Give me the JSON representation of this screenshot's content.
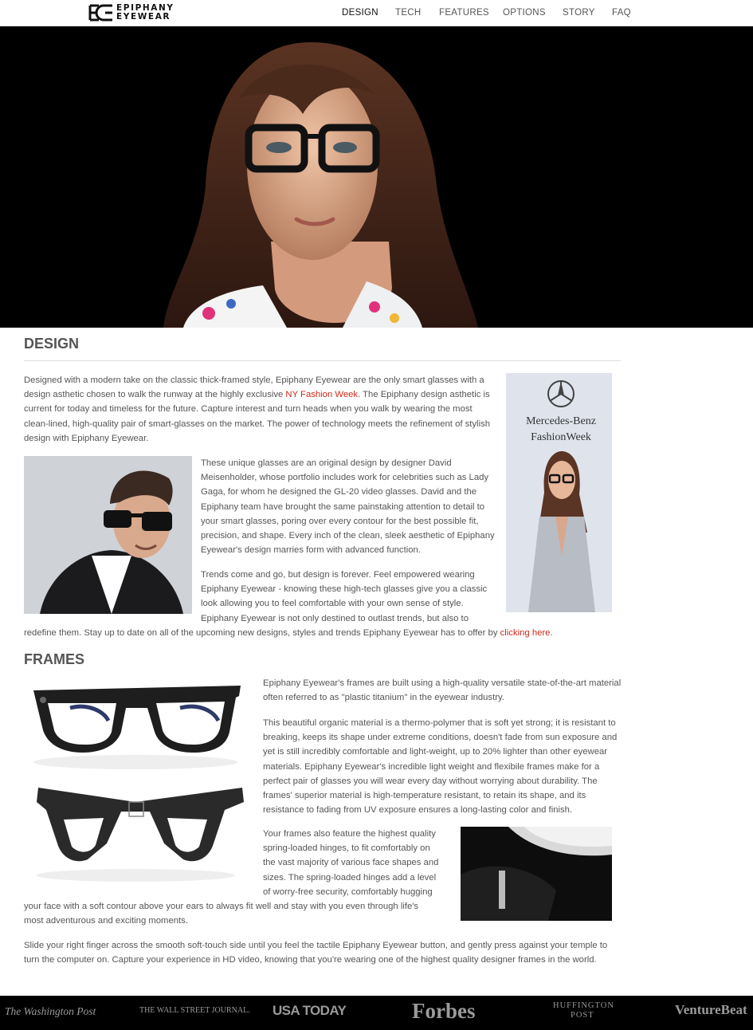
{
  "brand": {
    "line1": "EPIPHANY",
    "line2": "EYEWEAR"
  },
  "nav": {
    "items": [
      {
        "label": "DESIGN",
        "active": true
      },
      {
        "label": "TECH"
      },
      {
        "label": "FEATURES"
      },
      {
        "label": "OPTIONS"
      },
      {
        "label": "STORY"
      },
      {
        "label": "FAQ"
      }
    ]
  },
  "design": {
    "title": "DESIGN",
    "p1_before": "Designed with a modern take on the classic thick-framed style, Epiphany Eyewear are the only smart glasses with a design asthetic chosen to walk the runway at the highly exclusive ",
    "p1_link": "NY Fashion Week",
    "p1_after": ". The Epiphany design asthetic is current for today and timeless for the future. Capture interest and turn heads when you walk by wearing the most clean-lined, high-quality pair of smart-glasses on the market. The power of technology meets the refinement of stylish design with Epiphany Eyewear.",
    "p2": "These unique glasses are an original design by designer David Meisenholder, whose portfolio includes work for celebrities such as Lady Gaga, for whom he designed the GL-20 video glasses. David and the Epiphany team have brought the same painstaking attention to detail to your smart glasses, poring over every contour for the best possible fit, precision, and shape. Every inch of the clean, sleek aesthetic of Epiphany Eyewear's design marries form with advanced function.",
    "p3_a": "Trends come and go, but design is forever. Feel empowered wearing Epiphany Eyewear - knowing these high-tech glasses give you a classic look allowing you to feel comfortable with your own sense of style. Epiphany Eyewear is not only destined to outlast trends, but also to",
    "p3_b": "redefine them. Stay up to date on all of the upcoming new designs, styles and trends Epiphany Eyewear has to offer by ",
    "p3_link": "clicking here",
    "p3_end": ".",
    "sponsor_line1": "Mercedes-Benz",
    "sponsor_line2": "FashionWeek"
  },
  "frames": {
    "title": "FRAMES",
    "p1": "Epiphany Eyewear's frames are built using a high-quality versatile state-of-the-art material often referred to as \"plastic titanium\" in the eyewear industry.",
    "p2": "This beautiful organic material is a thermo-polymer that is soft yet strong; it is resistant to breaking, keeps its shape under extreme conditions, doesn't fade from sun exposure and yet is still incredibly comfortable and light-weight, up to 20% lighter than other eyewear materials. Epiphany Eyewear's incredible light weight and flexibile frames make for a perfect pair of glasses you will wear every day without worrying about durability. The frames' superior material is high-temperature resistant, to retain its shape, and its resistance to fading from UV exposure ensures a long-lasting color and finish.",
    "p3_a": "Your frames also feature the highest quality spring-loaded hinges, to fit comfortably on the vast majority of various face shapes and sizes. The spring-loaded hinges add a level of worry-free security, comfortably hugging",
    "p3_b": "your face with a soft contour above your ears to always fit well and stay with you even through life's most adventurous and exciting moments.",
    "p4": "Slide your right finger across the smooth soft-touch side until you feel the tactile Epiphany Eyewear button, and gently press against your temple to turn the computer on. Capture your experience in HD video, knowing that you're wearing one of the highest quality designer frames in the world."
  },
  "press": [
    "The Washington Post",
    "THE WALL STREET JOURNAL.",
    "USA TODAY",
    "Forbes",
    "HUFFINGTON",
    "POST",
    "VentureBeat"
  ],
  "colors": {
    "link": "#cc2a1a",
    "text": "#555555",
    "hero_bg": "#000000",
    "press_bg": "#000000"
  }
}
